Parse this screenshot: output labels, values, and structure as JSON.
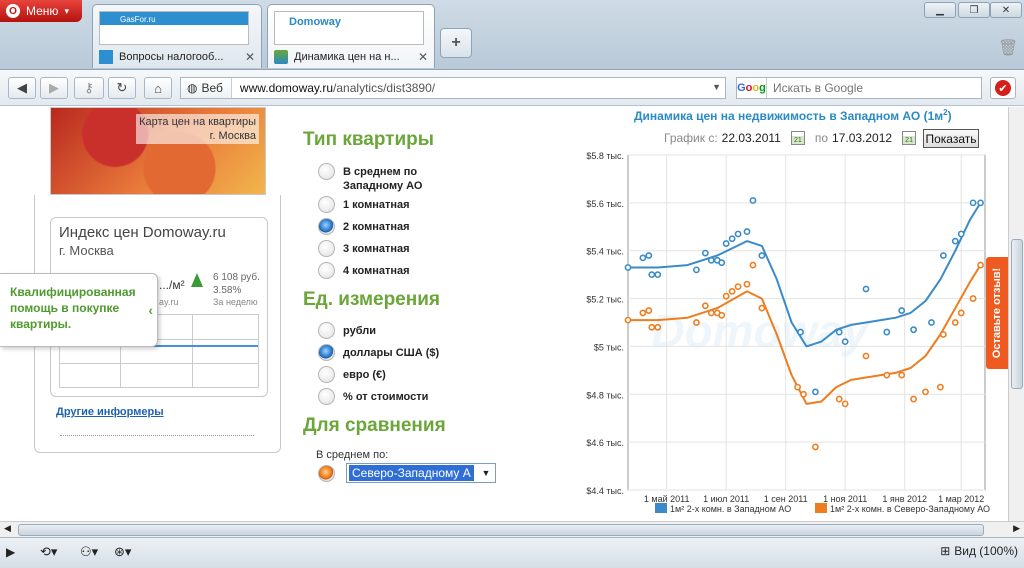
{
  "browser": {
    "menu_label": "Меню",
    "tabs": [
      {
        "title": "Вопросы налогооб...",
        "thumb_site": "GasFor.ru"
      },
      {
        "title": "Динамика цен на н...",
        "thumb_site": "Domoway"
      }
    ],
    "new_tab_label": "+",
    "address": {
      "prefix": "Веб",
      "host": "www.domoway.ru",
      "path": "/analytics/dist3890/"
    },
    "search_placeholder": "Искать в Google",
    "search_logo": "Google",
    "zoom_label": "Вид (100%)",
    "icons": [
      "back-icon",
      "forward-icon",
      "key-icon",
      "reload-icon",
      "home-icon",
      "search-engine-icon",
      "opera-icon"
    ]
  },
  "sidebar": {
    "map_label_line1": "Карта цен на квартиры",
    "map_label_line2": "г. Москва",
    "index_title": "Индекс цен Domoway.ru",
    "index_city": "г. Москва",
    "index_unit": ".../м²",
    "index_change_value": "6 108 руб.",
    "index_change_pct": "3.58%",
    "index_site": "ay.ru",
    "index_period": "За неделю",
    "callout_text": "Квалифицированная помощь в покупке квартиры.",
    "other_informers": "Другие информеры"
  },
  "filters": {
    "apartment_type_title": "Тип квартиры",
    "apartment_types": [
      {
        "label": "В среднем по Западному АО",
        "selected": false
      },
      {
        "label": "1 комнатная",
        "selected": false
      },
      {
        "label": "2 комнатная",
        "selected": true
      },
      {
        "label": "3 комнатная",
        "selected": false
      },
      {
        "label": "4 комнатная",
        "selected": false
      }
    ],
    "unit_title": "Ед. измерения",
    "units": [
      {
        "label": "рубли",
        "selected": false
      },
      {
        "label": "доллары США ($)",
        "selected": true
      },
      {
        "label": "евро (€)",
        "selected": false
      },
      {
        "label": "% от стоимости",
        "selected": false
      }
    ],
    "compare_title": "Для сравнения",
    "compare_caption": "В среднем по:",
    "compare_value": "Северо-Западному А"
  },
  "chart_header": {
    "title": "Динамика цен на недвижимость в Западном АО (1м",
    "title_sup": "2",
    "title_end": ")",
    "from_label": "График с:",
    "from_date": "22.03.2011",
    "to_label": "по",
    "to_date": "17.03.2012",
    "calendar_day": "21",
    "show_button": "Показать",
    "feedback_label": "Оставьте отзыв!",
    "watermark": "Domoway"
  },
  "chart_data": {
    "type": "line",
    "ylim": [
      4.4,
      5.8
    ],
    "yticks": [
      {
        "v": 5.8,
        "label": "$5.8 тыс."
      },
      {
        "v": 5.6,
        "label": "$5.6 тыс."
      },
      {
        "v": 5.4,
        "label": "$5.4 тыс."
      },
      {
        "v": 5.2,
        "label": "$5.2 тыс."
      },
      {
        "v": 5.0,
        "label": "$5 тыс."
      },
      {
        "v": 4.8,
        "label": "$4.8 тыс."
      },
      {
        "v": 4.6,
        "label": "$4.6 тыс."
      },
      {
        "v": 4.4,
        "label": "$4.4 тыс."
      }
    ],
    "xlim": [
      0,
      12
    ],
    "xticks": [
      {
        "t": 1.3,
        "label": "1 май 2011"
      },
      {
        "t": 3.3,
        "label": "1 июл 2011"
      },
      {
        "t": 5.3,
        "label": "1 сен 2011"
      },
      {
        "t": 7.3,
        "label": "1 ноя 2011"
      },
      {
        "t": 9.3,
        "label": "1 янв 2012"
      },
      {
        "t": 11.2,
        "label": "1 мар 2012"
      }
    ],
    "legend_position": "bottom",
    "series": [
      {
        "name": "2-х комн. в Западном АО",
        "legend_sup": "1м²",
        "color": "#3a8bc8",
        "points": [
          [
            0,
            5.33
          ],
          [
            0.5,
            5.37
          ],
          [
            0.7,
            5.38
          ],
          [
            0.8,
            5.3
          ],
          [
            1.0,
            5.3
          ],
          [
            2.3,
            5.32
          ],
          [
            2.6,
            5.39
          ],
          [
            2.8,
            5.36
          ],
          [
            3.0,
            5.36
          ],
          [
            3.15,
            5.35
          ],
          [
            3.3,
            5.43
          ],
          [
            3.5,
            5.45
          ],
          [
            3.7,
            5.47
          ],
          [
            4.0,
            5.48
          ],
          [
            4.2,
            5.61
          ],
          [
            4.5,
            5.38
          ],
          [
            5.8,
            5.06
          ],
          [
            6.3,
            4.81
          ],
          [
            7.1,
            5.06
          ],
          [
            7.3,
            5.02
          ],
          [
            8.0,
            5.24
          ],
          [
            8.7,
            5.06
          ],
          [
            9.2,
            5.15
          ],
          [
            9.6,
            5.07
          ],
          [
            10.2,
            5.1
          ],
          [
            10.6,
            5.38
          ],
          [
            11.0,
            5.44
          ],
          [
            11.2,
            5.47
          ],
          [
            11.6,
            5.6
          ],
          [
            11.85,
            5.6
          ]
        ],
        "trend": [
          [
            0,
            5.33
          ],
          [
            1,
            5.33
          ],
          [
            2,
            5.34
          ],
          [
            3,
            5.38
          ],
          [
            4,
            5.44
          ],
          [
            4.5,
            5.42
          ],
          [
            5,
            5.28
          ],
          [
            5.5,
            5.1
          ],
          [
            6,
            5.0
          ],
          [
            6.5,
            5.02
          ],
          [
            7,
            5.07
          ],
          [
            7.5,
            5.09
          ],
          [
            8,
            5.1
          ],
          [
            8.5,
            5.11
          ],
          [
            9,
            5.12
          ],
          [
            9.5,
            5.14
          ],
          [
            10,
            5.19
          ],
          [
            10.5,
            5.28
          ],
          [
            11,
            5.4
          ],
          [
            11.5,
            5.53
          ],
          [
            11.85,
            5.6
          ]
        ]
      },
      {
        "name": "2-х комн. в Северо-Западному АО",
        "legend_sup": "1м²",
        "color": "#ee7d1f",
        "points": [
          [
            0,
            5.11
          ],
          [
            0.5,
            5.14
          ],
          [
            0.7,
            5.15
          ],
          [
            0.8,
            5.08
          ],
          [
            1.0,
            5.08
          ],
          [
            2.3,
            5.1
          ],
          [
            2.6,
            5.17
          ],
          [
            2.8,
            5.14
          ],
          [
            3.0,
            5.14
          ],
          [
            3.15,
            5.13
          ],
          [
            3.3,
            5.21
          ],
          [
            3.5,
            5.23
          ],
          [
            3.7,
            5.25
          ],
          [
            4.0,
            5.26
          ],
          [
            4.2,
            5.34
          ],
          [
            4.5,
            5.16
          ],
          [
            5.7,
            4.83
          ],
          [
            5.9,
            4.8
          ],
          [
            6.3,
            4.58
          ],
          [
            7.1,
            4.78
          ],
          [
            7.3,
            4.76
          ],
          [
            8.0,
            4.96
          ],
          [
            8.7,
            4.88
          ],
          [
            9.2,
            4.88
          ],
          [
            9.6,
            4.78
          ],
          [
            10.0,
            4.81
          ],
          [
            10.5,
            4.83
          ],
          [
            10.6,
            5.05
          ],
          [
            11.0,
            5.1
          ],
          [
            11.2,
            5.14
          ],
          [
            11.6,
            5.2
          ],
          [
            11.85,
            5.34
          ]
        ],
        "trend": [
          [
            0,
            5.11
          ],
          [
            1,
            5.11
          ],
          [
            2,
            5.12
          ],
          [
            3,
            5.16
          ],
          [
            4,
            5.23
          ],
          [
            4.5,
            5.2
          ],
          [
            5,
            5.05
          ],
          [
            5.5,
            4.88
          ],
          [
            6,
            4.76
          ],
          [
            6.5,
            4.77
          ],
          [
            7,
            4.83
          ],
          [
            7.5,
            4.86
          ],
          [
            8,
            4.87
          ],
          [
            8.5,
            4.88
          ],
          [
            9,
            4.89
          ],
          [
            9.5,
            4.91
          ],
          [
            10,
            4.96
          ],
          [
            10.5,
            5.05
          ],
          [
            11,
            5.16
          ],
          [
            11.5,
            5.27
          ],
          [
            11.85,
            5.34
          ]
        ]
      }
    ]
  }
}
